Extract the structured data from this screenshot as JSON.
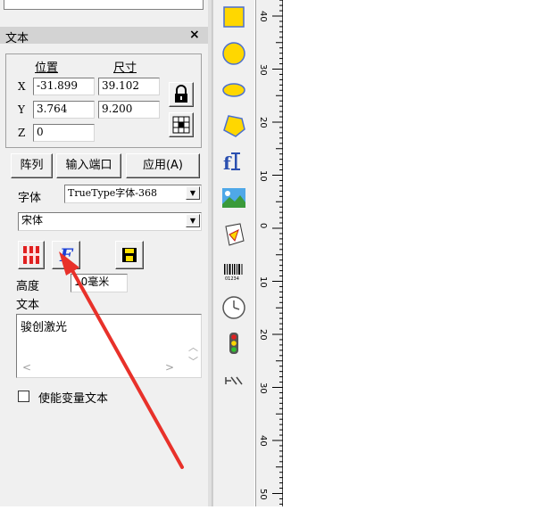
{
  "panel": {
    "title": "文本",
    "close": "×",
    "position_label": "位置",
    "size_label": "尺寸",
    "x_label": "X",
    "y_label": "Y",
    "z_label": "Z",
    "pos_x": "-31.899",
    "pos_y": "3.764",
    "pos_z": "0",
    "size_w": "39.102",
    "size_h": "9.200"
  },
  "buttons": {
    "array": "阵列",
    "import_port": "输入端口",
    "apply": "应用(A)"
  },
  "font": {
    "label": "字体",
    "type_value": "TrueType字体-368",
    "name_value": "宋体"
  },
  "height": {
    "label": "高度",
    "value": "10毫米"
  },
  "text": {
    "label": "文本",
    "value": "骏创激光"
  },
  "variable_text": {
    "label": "使能变量文本",
    "checked": false
  },
  "ruler": {
    "labels": [
      "40",
      "30",
      "20",
      "10",
      "0",
      "10",
      "20",
      "30",
      "40",
      "50"
    ]
  },
  "colors": {
    "panel_bg": "#f0f0f0",
    "shape_yellow": "#ffd700",
    "arrow_red": "#e8312a",
    "font_icon_blue": "#1a3fd8"
  }
}
